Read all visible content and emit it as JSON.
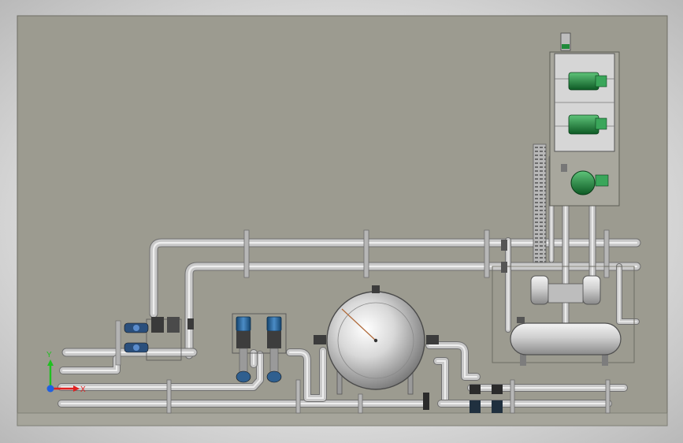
{
  "colors": {
    "background": "#9c9b90",
    "pipe": "#c9c9c9",
    "pipe_outline": "#6f6f6f",
    "pump_motor": "#2f6ea6",
    "dosing_pump": "#1f8a3a",
    "axis_x": "#e02020",
    "axis_y": "#20c020",
    "axis_z": "#2060e0"
  },
  "axes": {
    "x_label": "X",
    "y_label": "Y"
  },
  "icons": {
    "triad": "coordinate-triad-icon"
  }
}
